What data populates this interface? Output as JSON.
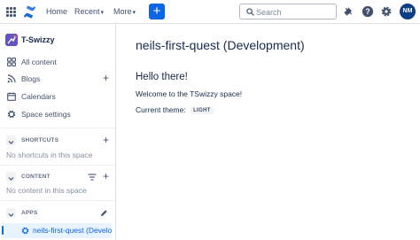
{
  "topnav": {
    "links": [
      "Home",
      "Recent",
      "More"
    ],
    "create_label": "+",
    "search_placeholder": "Search",
    "avatar_initials": "NM",
    "icons": [
      "app-switcher-icon",
      "confluence-logo-icon",
      "notifications-icon",
      "help-icon",
      "settings-icon"
    ]
  },
  "sidebar": {
    "space_name": "T-Swizzy",
    "items": [
      {
        "label": "All content",
        "icon": "all-content-icon"
      },
      {
        "label": "Blogs",
        "icon": "blogs-icon"
      },
      {
        "label": "Calendars",
        "icon": "calendar-icon"
      },
      {
        "label": "Space settings",
        "icon": "gear-icon"
      }
    ],
    "shortcuts": {
      "title": "SHORTCUTS",
      "empty_text": "No shortcuts in this space"
    },
    "content": {
      "title": "CONTENT",
      "empty_text": "No content in this space"
    },
    "apps": {
      "title": "APPS",
      "items": [
        {
          "label": "neils-first-quest (Development)"
        }
      ]
    }
  },
  "main": {
    "page_title": "neils-first-quest (Development)",
    "greeting": "Hello there!",
    "welcome": "Welcome to the TSwizzy space!",
    "theme_label": "Current theme:",
    "theme_value": "LIGHT"
  },
  "colors": {
    "accent": "#0c66e4",
    "selected_bg": "#e9f2ff",
    "text": "#172b4d",
    "muted_text": "#8590a2",
    "avatar_bg": "#0c3f86",
    "space_icon_bg": "#6554c0"
  }
}
